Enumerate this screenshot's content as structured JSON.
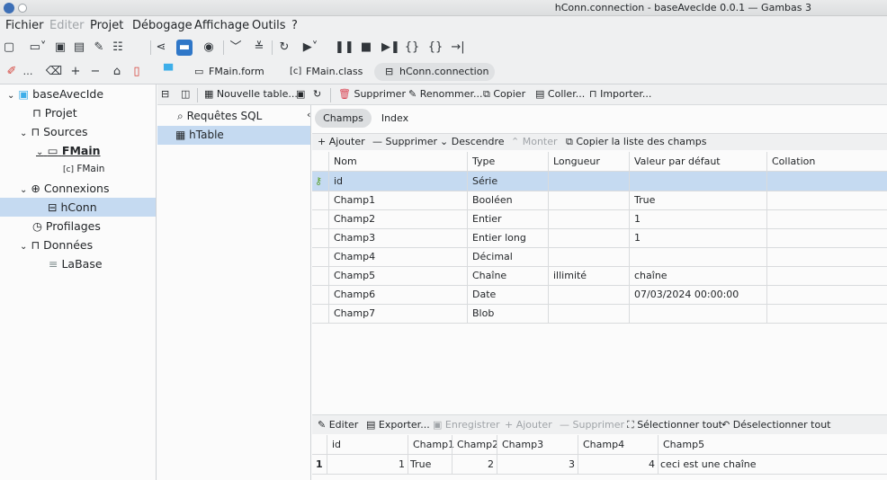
{
  "window": {
    "title": "hConn.connection - baseAvecIde 0.0.1 — Gambas 3"
  },
  "menu": [
    "Fichier",
    "Editer",
    "Projet",
    "Débogage",
    "Affichage",
    "Outils",
    "?"
  ],
  "tabs": [
    {
      "label": "FMain.form"
    },
    {
      "label": "FMain.class"
    },
    {
      "label": "hConn.connection"
    }
  ],
  "project_tree": {
    "root": "baseAvecIde",
    "items": [
      {
        "label": "Projet"
      },
      {
        "label": "Sources"
      },
      {
        "label": "FMain"
      },
      {
        "label": "FMain"
      },
      {
        "label": "Connexions"
      },
      {
        "label": "hConn"
      },
      {
        "label": "Profilages"
      },
      {
        "label": "Données"
      },
      {
        "label": "LaBase"
      }
    ]
  },
  "db_toolbar": {
    "new_table": "Nouvelle table...",
    "delete": "Supprimer",
    "rename": "Renommer...",
    "copy": "Copier",
    "paste": "Coller...",
    "import": "Importer..."
  },
  "tables_list": [
    {
      "label": "Requêtes SQL"
    },
    {
      "label": "hTable"
    }
  ],
  "field_tabs": [
    "Champs",
    "Index"
  ],
  "field_actions": {
    "add": "Ajouter",
    "delete": "Supprimer",
    "down": "Descendre",
    "up": "Monter",
    "copy_list": "Copier la liste des champs"
  },
  "fields": {
    "columns": [
      "Nom",
      "Type",
      "Longueur",
      "Valeur par défaut",
      "Collation"
    ],
    "rows": [
      [
        "id",
        "Série",
        "",
        "",
        ""
      ],
      [
        "Champ1",
        "Booléen",
        "",
        "True",
        ""
      ],
      [
        "Champ2",
        "Entier",
        "",
        "1",
        ""
      ],
      [
        "Champ3",
        "Entier long",
        "",
        "1",
        ""
      ],
      [
        "Champ4",
        "Décimal",
        "",
        "",
        ""
      ],
      [
        "Champ5",
        "Chaîne",
        "illimité",
        "chaîne",
        ""
      ],
      [
        "Champ6",
        "Date",
        "",
        "07/03/2024 00:00:00",
        ""
      ],
      [
        "Champ7",
        "Blob",
        "",
        "",
        ""
      ]
    ]
  },
  "data_actions": {
    "edit": "Editer",
    "export": "Exporter...",
    "save": "Enregistrer",
    "add": "Ajouter",
    "delete": "Supprimer",
    "select_all": "Sélectionner tout",
    "unselect_all": "Déselectionner tout"
  },
  "data_grid": {
    "columns": [
      "id",
      "Champ1",
      "Champ2",
      "Champ3",
      "Champ4",
      "Champ5"
    ],
    "rows": [
      {
        "num": "1",
        "cells": [
          "1",
          "True",
          "2",
          "3",
          "4",
          "ceci est une chaîne"
        ]
      }
    ]
  },
  "colors": {
    "selection": "#c5daf1",
    "accent": "#3daee9"
  }
}
